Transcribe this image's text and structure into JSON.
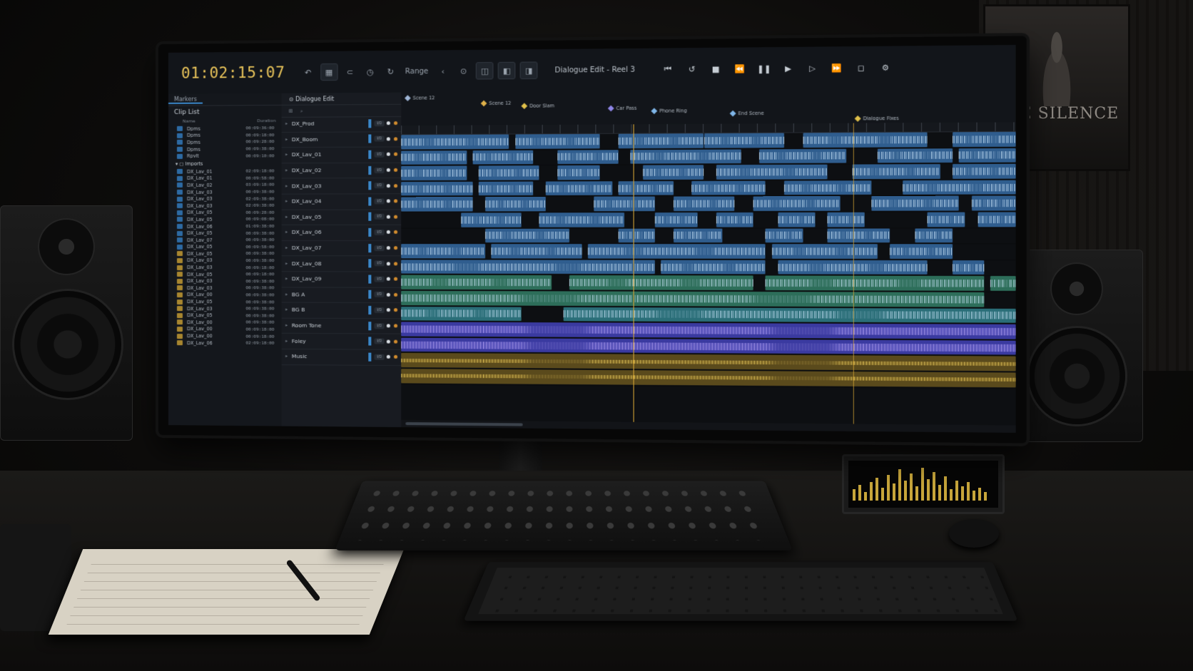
{
  "app": {
    "timecode": "01:02:15:07",
    "range_label": "Range",
    "session_title": "Dialogue Edit - Reel 3"
  },
  "left_panel": {
    "tab": "Markers",
    "title": "Clip List",
    "headers": [
      "Name",
      "Duration"
    ],
    "group_top": [
      {
        "name": "Dpms",
        "time": "00:09:36:00"
      },
      {
        "name": "Dpms",
        "time": "00:09:18:00"
      },
      {
        "name": "Dpms",
        "time": "00:09:28:00"
      },
      {
        "name": "Dpms",
        "time": "00:09:38:00"
      },
      {
        "name": "Rpvlt",
        "time": "00:09:10:00"
      }
    ],
    "folder": "Imports",
    "clips": [
      {
        "name": "DX_Lav_01",
        "time": "02:09:18:00"
      },
      {
        "name": "DX_Lav_01",
        "time": "00:09:58:00"
      },
      {
        "name": "DX_Lav_02",
        "time": "03:09:18:00"
      },
      {
        "name": "DX_Lav_03",
        "time": "00:09:38:00"
      },
      {
        "name": "DX_Lav_03",
        "time": "02:09:38:00"
      },
      {
        "name": "DX_Lav_03",
        "time": "02:09:38:00"
      },
      {
        "name": "DX_Lav_05",
        "time": "00:09:28:00"
      },
      {
        "name": "DX_Lav_05",
        "time": "00:09:08:00"
      },
      {
        "name": "DX_Lav_06",
        "time": "01:09:38:00"
      },
      {
        "name": "DX_Lav_05",
        "time": "00:09:38:00"
      },
      {
        "name": "DX_Lav_07",
        "time": "00:09:38:00"
      },
      {
        "name": "DX_Lav_05",
        "time": "00:09:58:00"
      },
      {
        "name": "DX_Lav_05",
        "time": "00:09:38:00"
      },
      {
        "name": "DX_Lav_03",
        "time": "00:09:38:00"
      },
      {
        "name": "DX_Lav_03",
        "time": "00:09:18:00"
      },
      {
        "name": "DX_Lav_05",
        "time": "00:09:18:00"
      },
      {
        "name": "DX_Lav_03",
        "time": "00:09:38:00"
      },
      {
        "name": "DX_Lav_03",
        "time": "00:09:38:00"
      },
      {
        "name": "DX_Lav_00",
        "time": "00:09:38:00"
      },
      {
        "name": "DX_Lav_05",
        "time": "00:09:38:00"
      },
      {
        "name": "DX_Lav_03",
        "time": "00:09:38:00"
      },
      {
        "name": "DX_Lav_05",
        "time": "00:09:38:00"
      },
      {
        "name": "DX_Lav_00",
        "time": "00:09:38:00"
      },
      {
        "name": "DX_Lav_00",
        "time": "00:09:18:00"
      },
      {
        "name": "DX_Lav_00",
        "time": "00:09:18:00"
      },
      {
        "name": "DX_Lav_06",
        "time": "02:09:18:00"
      }
    ]
  },
  "track_panel": {
    "sequence_tab": "Dialogue Edit",
    "tracks": [
      {
        "name": "DX_Prod"
      },
      {
        "name": "DX_Boom"
      },
      {
        "name": "DX_Lav_01"
      },
      {
        "name": "DX_Lav_02"
      },
      {
        "name": "DX_Lav_03"
      },
      {
        "name": "DX_Lav_04"
      },
      {
        "name": "DX_Lav_05"
      },
      {
        "name": "DX_Lav_06"
      },
      {
        "name": "DX_Lav_07"
      },
      {
        "name": "DX_Lav_08"
      },
      {
        "name": "DX_Lav_09"
      },
      {
        "name": "BG A"
      },
      {
        "name": "BG B"
      },
      {
        "name": "Room Tone"
      },
      {
        "name": "Foley"
      },
      {
        "name": "Music"
      }
    ]
  },
  "markers": [
    {
      "label": "Scene 12",
      "color": "#9fb6d6"
    },
    {
      "label": "Scene 12",
      "color": "#e0b24a"
    },
    {
      "label": "Door Slam",
      "color": "#e0c04a"
    },
    {
      "label": "Car Pass",
      "color": "#8f86e8"
    },
    {
      "label": "Phone Ring",
      "color": "#7fb6e8"
    },
    {
      "label": "End Scene",
      "color": "#7fb6e8"
    },
    {
      "label": "Dialogue Fixes",
      "color": "#e0c04a"
    }
  ],
  "poster": {
    "title": "THE SILENCE"
  },
  "colors": {
    "dialogue_clip": "#2f5d8e",
    "bg_clip": "#2d6e5a",
    "roomtone_clip": "#3a3aa0",
    "music_clip": "#5a4a1c",
    "timecode": "#e9c45a",
    "playhead": "#d8a634"
  }
}
